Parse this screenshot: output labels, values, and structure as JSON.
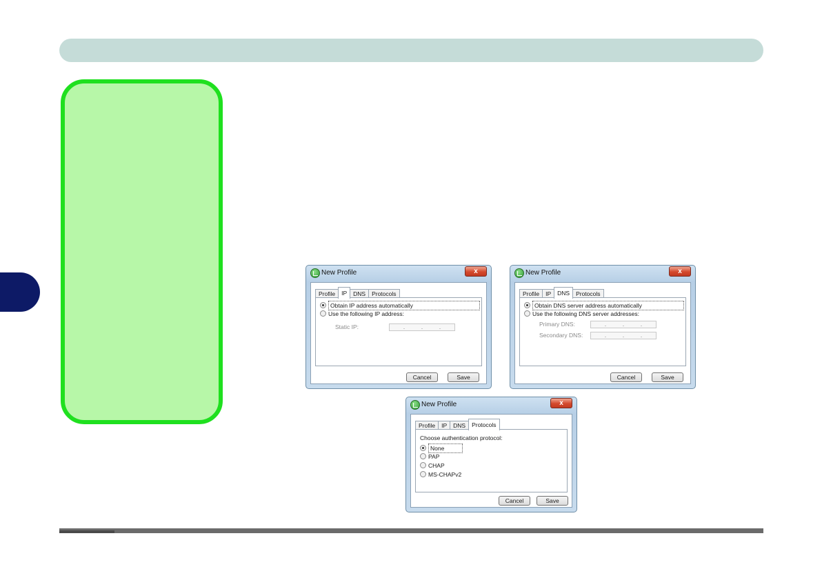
{
  "dialog_ip": {
    "title": "New Profile",
    "close": "x",
    "tabs": [
      "Profile",
      "IP",
      "DNS",
      "Protocols"
    ],
    "option_auto": "Obtain IP address automatically",
    "option_manual": "Use the following IP address:",
    "static_ip_label": "Static IP:",
    "cancel": "Cancel",
    "save": "Save"
  },
  "dialog_dns": {
    "title": "New Profile",
    "close": "x",
    "tabs": [
      "Profile",
      "IP",
      "DNS",
      "Protocols"
    ],
    "option_auto": "Obtain DNS server address automatically",
    "option_manual": "Use the following DNS server addresses:",
    "primary_label": "Primary DNS:",
    "secondary_label": "Secondary DNS:",
    "cancel": "Cancel",
    "save": "Save"
  },
  "dialog_protocols": {
    "title": "New Profile",
    "close": "x",
    "tabs": [
      "Profile",
      "IP",
      "DNS",
      "Protocols"
    ],
    "prompt": "Choose authentication protocol:",
    "options": [
      "None",
      "PAP",
      "CHAP",
      "MS-CHAPv2"
    ],
    "cancel": "Cancel",
    "save": "Save"
  },
  "ip_separator": "."
}
